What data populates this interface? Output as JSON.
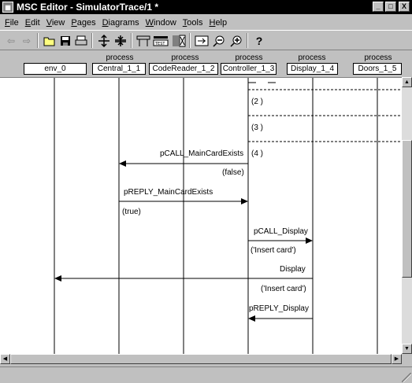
{
  "window": {
    "title": "MSC Editor - SimulatorTrace/1 *",
    "minimize": "_",
    "maximize": "□",
    "close": "X"
  },
  "menu": [
    {
      "label": "File",
      "u": "F",
      "rest": "ile"
    },
    {
      "label": "Edit",
      "u": "E",
      "rest": "dit"
    },
    {
      "label": "View",
      "u": "V",
      "rest": "iew"
    },
    {
      "label": "Pages",
      "u": "P",
      "rest": "ages"
    },
    {
      "label": "Diagrams",
      "u": "D",
      "rest": "iagrams"
    },
    {
      "label": "Window",
      "u": "W",
      "rest": "indow"
    },
    {
      "label": "Tools",
      "u": "T",
      "rest": "ools"
    },
    {
      "label": "Help",
      "u": "H",
      "rest": "elp"
    }
  ],
  "toolbar": {
    "back_icon": "⇦",
    "forward_icon": "⇨",
    "open_icon": "📂",
    "save_icon": "▣",
    "print_icon": "⎙",
    "help_label": "?"
  },
  "instances": [
    {
      "kind": "",
      "name": "env_0"
    },
    {
      "kind": "process",
      "name": "Central_1_1"
    },
    {
      "kind": "process",
      "name": "CodeReader_1_2"
    },
    {
      "kind": "process",
      "name": "Controller_1_3"
    },
    {
      "kind": "process",
      "name": "Display_1_4"
    },
    {
      "kind": "process",
      "name": "Doors_1_5"
    }
  ],
  "conditions": [
    "(2  )",
    "(3  )",
    "(4  )"
  ],
  "messages": {
    "m1": "pCALL_MainCardExists",
    "m1_param": "(false)",
    "m2": "pREPLY_MainCardExists",
    "m2_param": "(true)",
    "m3": "pCALL_Display",
    "m3_param": "('Insert card')",
    "m4": "Display",
    "m4_param": "('Insert card')",
    "m5": "pREPLY_Display"
  }
}
